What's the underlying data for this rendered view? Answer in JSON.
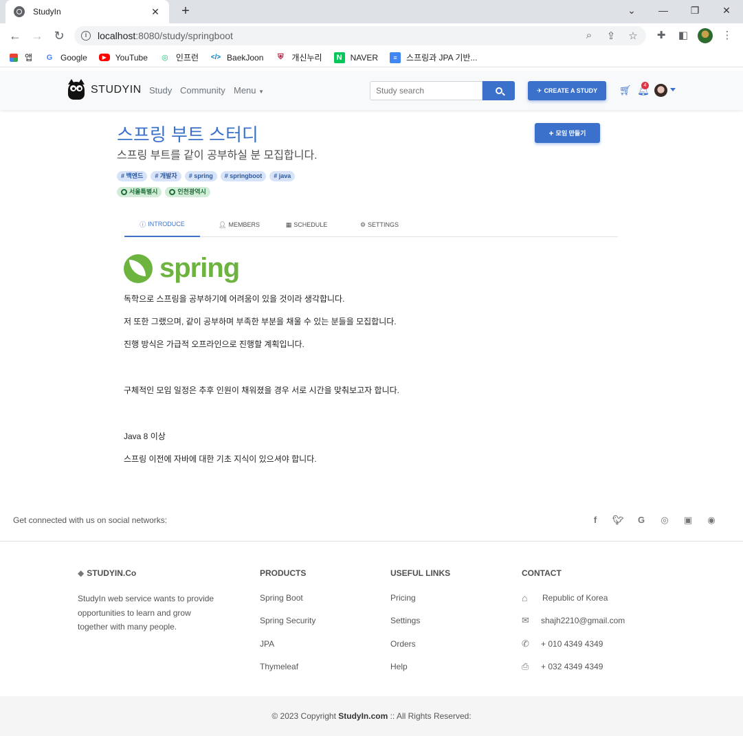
{
  "browser": {
    "tab_title": "StudyIn",
    "url_host": "localhost",
    "url_path": ":8080/study/springboot",
    "bookmarks": [
      "앱",
      "Google",
      "YouTube",
      "인프런",
      "BaekJoon",
      "개신누리",
      "NAVER",
      "스프링과 JPA 기반..."
    ]
  },
  "navbar": {
    "brand": "STUDYIN",
    "links": [
      "Study",
      "Community",
      "Menu"
    ],
    "search_placeholder": "Study search",
    "create_label": "CREATE A STUDY",
    "notification_count": "4"
  },
  "study": {
    "title": "스프링 부트 스터디",
    "subtitle": "스프링 부트를 같이 공부하실 분 모집합니다.",
    "meet_button": "모임 만들기",
    "tags": [
      "백엔드",
      "개발자",
      "spring",
      "springboot",
      "java"
    ],
    "zones": [
      "서울특별시",
      "인천광역시"
    ]
  },
  "tabs": [
    {
      "label": "INTRODUCE",
      "active": true
    },
    {
      "label": "MEMBERS",
      "active": false
    },
    {
      "label": "SCHEDULE",
      "active": false
    },
    {
      "label": "SETTINGS",
      "active": false
    }
  ],
  "content": {
    "logo_text": "spring",
    "paragraphs": [
      "독학으로 스프링을 공부하기에 어려움이 있을 것이라 생각합니다.",
      "저 또한 그랬으며, 같이 공부하며 부족한 부분을 채울 수 있는 분들을 모집합니다.",
      "진행 방식은 가급적 오프라인으로 진행할 계획입니다.",
      "구체적인 모임 일정은 추후 인원이 채워졌을 경우 서로 시간을 맞춰보고자 합니다.",
      "Java 8 이상",
      "스프링 이전에 자바에 대한 기초 지식이 있으셔야 합니다."
    ]
  },
  "social": {
    "text": "Get connected with us on social networks:",
    "icons": [
      "facebook-icon",
      "twitter-icon",
      "google-icon",
      "instagram-icon",
      "linkedin-icon",
      "github-icon"
    ]
  },
  "footer": {
    "brand": "STUDYIN.Co",
    "about": "StudyIn web service wants to provide opportunities to learn and grow together with many people.",
    "products_title": "PRODUCTS",
    "products": [
      "Spring Boot",
      "Spring Security",
      "JPA",
      "Thymeleaf"
    ],
    "links_title": "USEFUL LINKS",
    "links": [
      "Pricing",
      "Settings",
      "Orders",
      "Help"
    ],
    "contact_title": "CONTACT",
    "contact": [
      "Republic of Korea",
      "shajh2210@gmail.com",
      "+ 010 4349 4349",
      "+ 032 4349 4349"
    ],
    "copyright_prefix": "© 2023 Copyright ",
    "copyright_brand": "StudyIn.com",
    "copyright_suffix": " :: All Rights Reserved:"
  },
  "colors": {
    "primary": "#3b71ca",
    "spring_green": "#6db33f"
  }
}
